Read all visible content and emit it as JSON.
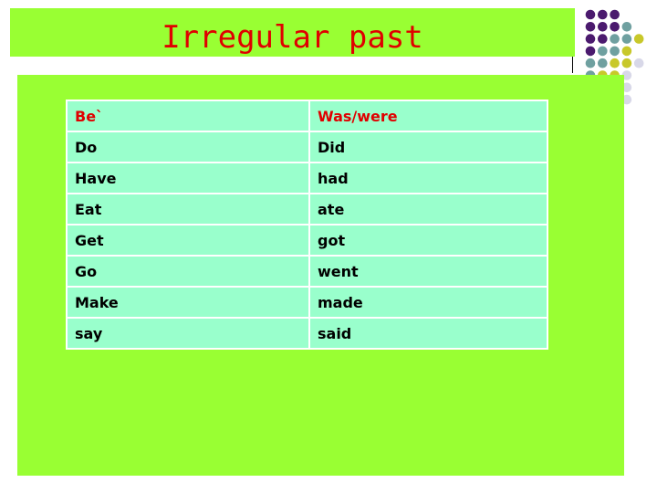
{
  "title": "Irregular past",
  "colors": {
    "background_green": "#99ff33",
    "table_fill": "#99ffcc",
    "title_red": "#e00000",
    "header_red": "#e00000"
  },
  "decoration": {
    "dot_colors": [
      "#4b1a6e",
      "#6fa0a0",
      "#c8c82a",
      "#d8d8e8"
    ]
  },
  "table": {
    "header": [
      "Be`",
      "Was/were"
    ],
    "rows": [
      [
        "Do",
        "Did"
      ],
      [
        "Have",
        "had"
      ],
      [
        "Eat",
        "ate"
      ],
      [
        "Get",
        "got"
      ],
      [
        "Go",
        "went"
      ],
      [
        "Make",
        "made"
      ],
      [
        "say",
        "said"
      ]
    ]
  }
}
